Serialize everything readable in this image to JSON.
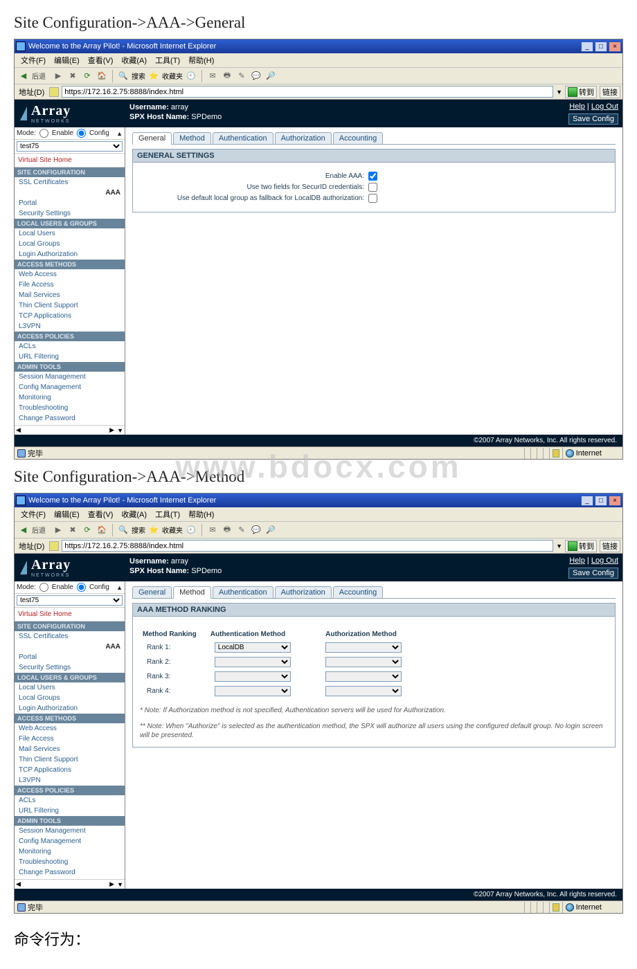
{
  "headings": {
    "h1": "Site Configuration->AAA->General",
    "h2": "Site Configuration->AAA->Method",
    "cmd_note": "命令行为：",
    "watermark": "www.bdocx.com"
  },
  "ie": {
    "title": "Welcome to the Array Pilot! - Microsoft Internet Explorer",
    "menu": [
      "文件(F)",
      "编辑(E)",
      "查看(V)",
      "收藏(A)",
      "工具(T)",
      "帮助(H)"
    ],
    "addr_label": "地址(D)",
    "url": "https://172.16.2.75:8888/index.html",
    "go_btn": "转到",
    "links_btn": "链接",
    "status_done": "完毕",
    "status_zone": "Internet"
  },
  "array": {
    "logo": "Array",
    "logo_sub": "NETWORKS",
    "username_lbl": "Username:",
    "username_val": "array",
    "host_lbl": "SPX Host Name:",
    "host_val": "SPDemo",
    "help": "Help",
    "logout": "Log Out",
    "save": "Save Config",
    "footer": "©2007 Array Networks, Inc. All rights reserved."
  },
  "sidebar": {
    "mode_label": "Mode:",
    "mode_enable": "Enable",
    "mode_config": "Config",
    "site_select": "test75",
    "virtual_site_home": "Virtual Site Home",
    "cat_site": "SITE CONFIGURATION",
    "cat_site_items": [
      "SSL Certificates",
      "AAA",
      "Portal",
      "Security Settings"
    ],
    "cat_local": "LOCAL USERS & GROUPS",
    "cat_local_items": [
      "Local Users",
      "Local Groups",
      "Login Authorization"
    ],
    "cat_access": "ACCESS METHODS",
    "cat_access_items": [
      "Web Access",
      "File Access",
      "Mail Services",
      "Thin Client Support",
      "TCP Applications",
      "L3VPN"
    ],
    "cat_policies": "ACCESS POLICIES",
    "cat_policies_items": [
      "ACLs",
      "URL Filtering"
    ],
    "cat_admin": "ADMIN TOOLS",
    "cat_admin_items": [
      "Session Management",
      "Config Management",
      "Monitoring",
      "Troubleshooting",
      "Change Password"
    ]
  },
  "tabs": [
    "General",
    "Method",
    "Authentication",
    "Authorization",
    "Accounting"
  ],
  "general_panel": {
    "title": "GENERAL SETTINGS",
    "row1": "Enable AAA:",
    "row2": "Use two fields for SecurID credentials:",
    "row3": "Use default local group as fallback for LocalDB authorization:"
  },
  "method_panel": {
    "title": "AAA METHOD RANKING",
    "col1": "Method Ranking",
    "col2": "Authentication Method",
    "col3": "Authorization Method",
    "ranks": [
      "Rank 1:",
      "Rank 2:",
      "Rank 3:",
      "Rank 4:"
    ],
    "auth1": "LocalDB",
    "blank": "",
    "note1": "* Note: If Authorization method is not specified, Authentication servers will be used for Authorization.",
    "note2": "** Note: When \"Authorize\" is selected as the authentication method, the SPX will authorize all users using the configured default group. No login screen will be presented."
  }
}
